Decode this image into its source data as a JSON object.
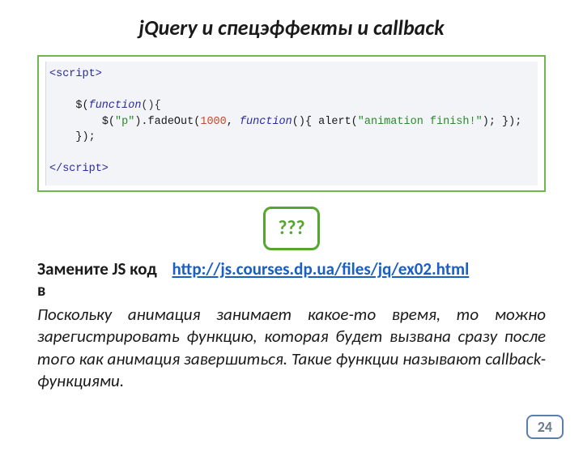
{
  "title": "jQuery и спецэффекты и callback",
  "code": {
    "open_tag": "<script>",
    "close_tag": "</script>",
    "fn_kw1": "function",
    "line1_rest": "(){",
    "line2_a": "$(",
    "line2_str1": "\"p\"",
    "line2_b": ").fadeOut(",
    "line2_num": "1000",
    "line2_c": ", ",
    "fn_kw2": "function",
    "line2_d": "(){ alert(",
    "line2_str2": "\"animation finish!\"",
    "line2_e": "); });",
    "line3": "});"
  },
  "badge": "???",
  "instruction_prefix": "Замените JS код",
  "instruction_suffix": "в",
  "link_text": "http://js.courses.dp.ua/files/jq/ex02.html",
  "link_href": "http://js.courses.dp.ua/files/jq/ex02.html",
  "body": "Поскольку анимация занимает какое-то время, то можно зарегистрировать функцию, которая будет вызвана сразу после того как анимация завершиться. Такие функции называют callback-функциями.",
  "page_number": "24"
}
